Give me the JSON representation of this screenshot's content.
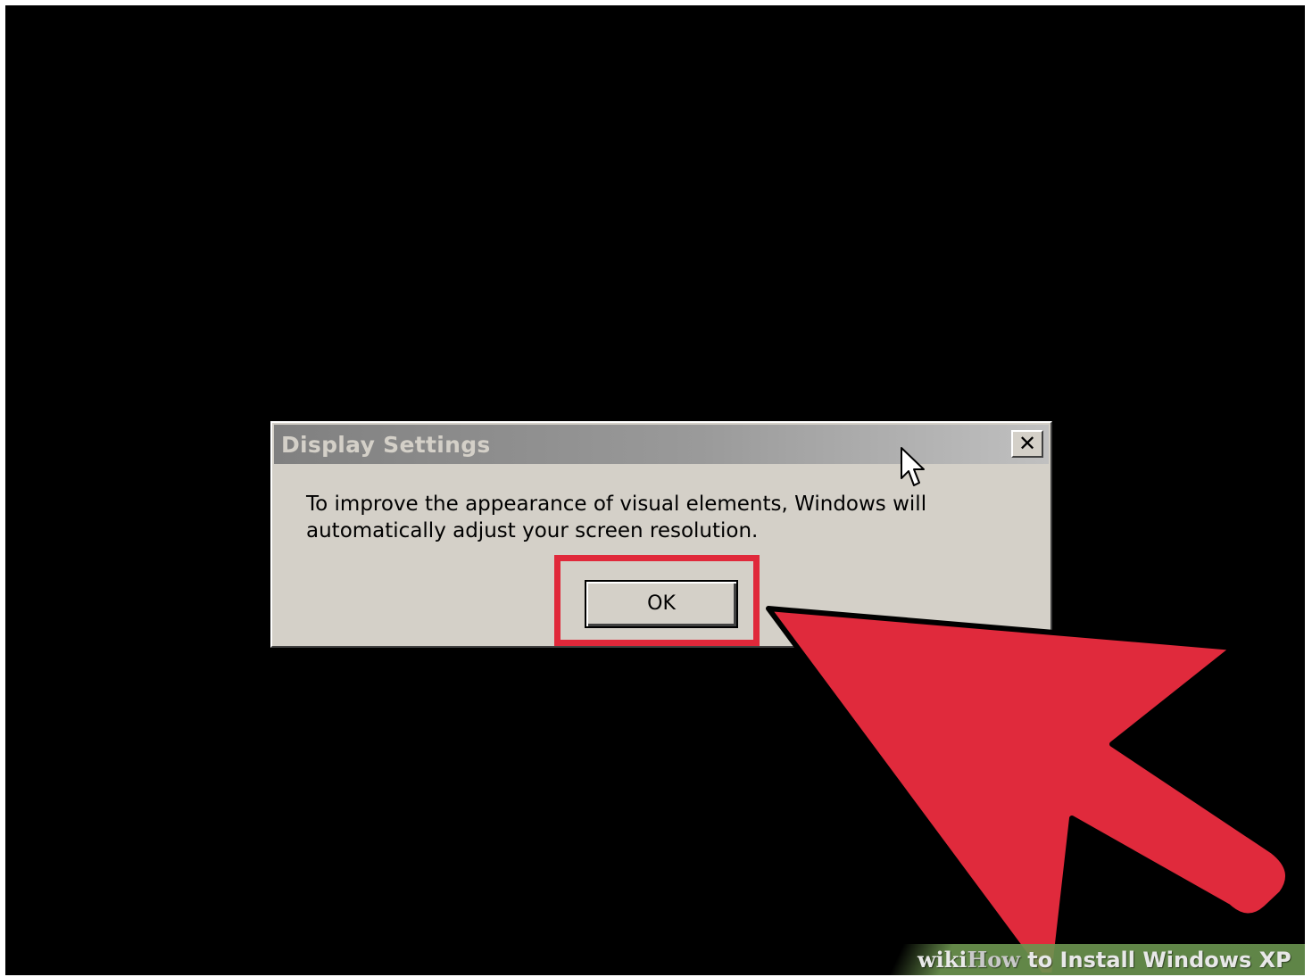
{
  "dialog": {
    "title": "Display Settings",
    "close_label": "✕",
    "message": "To improve the appearance of visual elements, Windows will automatically adjust your screen resolution.",
    "ok_label": "OK"
  },
  "watermark": {
    "brand_wiki": "wiki",
    "brand_how": "How",
    "caption": " to Install Windows XP"
  },
  "colors": {
    "highlight": "#e0283a",
    "dialog_face": "#d4d0c8",
    "background": "#000000"
  },
  "icons": {
    "pointer": "arrow-cursor-icon",
    "annotation": "red-arrow-icon"
  }
}
